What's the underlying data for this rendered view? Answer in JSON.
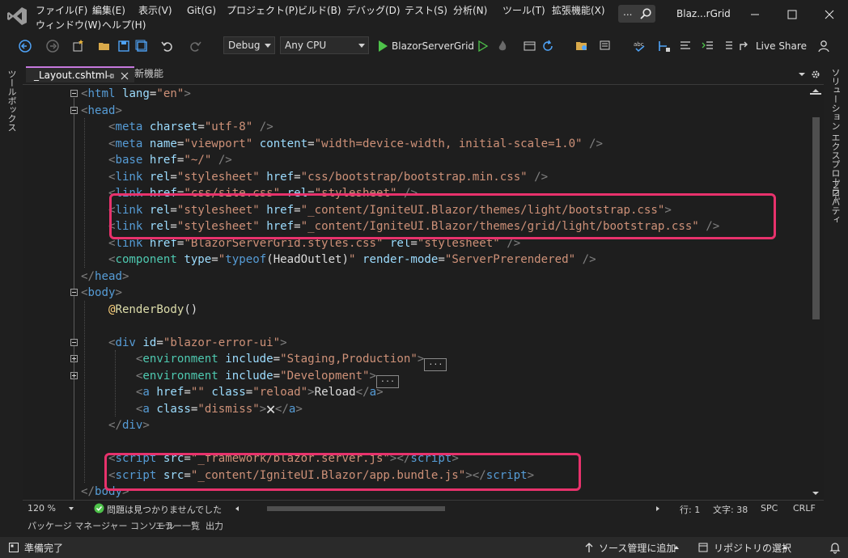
{
  "menu": {
    "items": [
      "ファイル(F)",
      "編集(E)",
      "表示(V)",
      "Git(G)",
      "プロジェクト(P)",
      "ビルド(B)",
      "デバッグ(D)",
      "テスト(S)",
      "分析(N)",
      "ツール(T)",
      "拡張機能(X)"
    ],
    "items2": [
      "ウィンドウ(W)",
      "ヘルプ(H)"
    ],
    "search_dots": "...",
    "window_title": "Blaz...rGrid"
  },
  "toolbar": {
    "config": "Debug",
    "platform": "Any CPU",
    "run_target": "BlazorServerGrid",
    "live_share": "Live Share"
  },
  "side": {
    "left_label": "ツールボックス",
    "right_label_1": "ソリューション エクスプローラー",
    "right_label_2": "プロパティ"
  },
  "tabs": {
    "active": "_Layout.cshtml",
    "second": "新機能"
  },
  "code": {
    "lines": [
      [
        [
          "t-br",
          "<"
        ],
        [
          "t-tag",
          "html"
        ],
        [
          "t-txt",
          " "
        ],
        [
          "t-attr",
          "lang"
        ],
        [
          "t-txt",
          "="
        ],
        [
          "t-str",
          "\"en\""
        ],
        [
          "t-br",
          ">"
        ]
      ],
      [
        [
          "t-br",
          "<"
        ],
        [
          "t-tag",
          "head"
        ],
        [
          "t-br",
          ">"
        ]
      ],
      [
        [
          "t-txt",
          "    "
        ],
        [
          "t-br",
          "<"
        ],
        [
          "t-tag",
          "meta"
        ],
        [
          "t-txt",
          " "
        ],
        [
          "t-attr",
          "charset"
        ],
        [
          "t-txt",
          "="
        ],
        [
          "t-str",
          "\"utf-8\""
        ],
        [
          "t-txt",
          " "
        ],
        [
          "t-br",
          "/>"
        ]
      ],
      [
        [
          "t-txt",
          "    "
        ],
        [
          "t-br",
          "<"
        ],
        [
          "t-tag",
          "meta"
        ],
        [
          "t-txt",
          " "
        ],
        [
          "t-attr",
          "name"
        ],
        [
          "t-txt",
          "="
        ],
        [
          "t-str",
          "\"viewport\""
        ],
        [
          "t-txt",
          " "
        ],
        [
          "t-attr",
          "content"
        ],
        [
          "t-txt",
          "="
        ],
        [
          "t-str",
          "\"width=device-width, initial-scale=1.0\""
        ],
        [
          "t-txt",
          " "
        ],
        [
          "t-br",
          "/>"
        ]
      ],
      [
        [
          "t-txt",
          "    "
        ],
        [
          "t-br",
          "<"
        ],
        [
          "t-tag",
          "base"
        ],
        [
          "t-txt",
          " "
        ],
        [
          "t-attr",
          "href"
        ],
        [
          "t-txt",
          "="
        ],
        [
          "t-str",
          "\"~/\""
        ],
        [
          "t-txt",
          " "
        ],
        [
          "t-br",
          "/>"
        ]
      ],
      [
        [
          "t-txt",
          "    "
        ],
        [
          "t-br",
          "<"
        ],
        [
          "t-tag",
          "link"
        ],
        [
          "t-txt",
          " "
        ],
        [
          "t-attr",
          "rel"
        ],
        [
          "t-txt",
          "="
        ],
        [
          "t-str",
          "\"stylesheet\""
        ],
        [
          "t-txt",
          " "
        ],
        [
          "t-attr",
          "href"
        ],
        [
          "t-txt",
          "="
        ],
        [
          "t-str",
          "\"css/bootstrap/bootstrap.min.css\""
        ],
        [
          "t-txt",
          " "
        ],
        [
          "t-br",
          "/>"
        ]
      ],
      [
        [
          "t-txt",
          "    "
        ],
        [
          "t-br",
          "<"
        ],
        [
          "t-tag",
          "link"
        ],
        [
          "t-txt",
          " "
        ],
        [
          "t-attr",
          "href"
        ],
        [
          "t-txt",
          "="
        ],
        [
          "t-str",
          "\"css/site.css\""
        ],
        [
          "t-txt",
          " "
        ],
        [
          "t-attr",
          "rel"
        ],
        [
          "t-txt",
          "="
        ],
        [
          "t-str",
          "\"stylesheet\""
        ],
        [
          "t-txt",
          " "
        ],
        [
          "t-br",
          "/>"
        ]
      ],
      [
        [
          "t-txt",
          "    "
        ],
        [
          "t-br",
          "<"
        ],
        [
          "t-tag",
          "link"
        ],
        [
          "t-txt",
          " "
        ],
        [
          "t-attr",
          "rel"
        ],
        [
          "t-txt",
          "="
        ],
        [
          "t-str",
          "\"stylesheet\""
        ],
        [
          "t-txt",
          " "
        ],
        [
          "t-attr",
          "href"
        ],
        [
          "t-txt",
          "="
        ],
        [
          "t-str",
          "\"_content/IgniteUI.Blazor/themes/light/bootstrap.css\""
        ],
        [
          "t-br",
          ">"
        ]
      ],
      [
        [
          "t-txt",
          "    "
        ],
        [
          "t-br",
          "<"
        ],
        [
          "t-tag",
          "link"
        ],
        [
          "t-txt",
          " "
        ],
        [
          "t-attr",
          "rel"
        ],
        [
          "t-txt",
          "="
        ],
        [
          "t-str",
          "\"stylesheet\""
        ],
        [
          "t-txt",
          " "
        ],
        [
          "t-attr",
          "href"
        ],
        [
          "t-txt",
          "="
        ],
        [
          "t-str",
          "\"_content/IgniteUI.Blazor/themes/grid/light/bootstrap.css\""
        ],
        [
          "t-txt",
          " "
        ],
        [
          "t-br",
          "/>"
        ]
      ],
      [
        [
          "t-txt",
          "    "
        ],
        [
          "t-br",
          "<"
        ],
        [
          "t-tag",
          "link"
        ],
        [
          "t-txt",
          " "
        ],
        [
          "t-attr",
          "href"
        ],
        [
          "t-txt",
          "="
        ],
        [
          "t-str",
          "\"BlazorServerGrid.styles.css\""
        ],
        [
          "t-txt",
          " "
        ],
        [
          "t-attr",
          "rel"
        ],
        [
          "t-txt",
          "="
        ],
        [
          "t-str",
          "\"stylesheet\""
        ],
        [
          "t-txt",
          " "
        ],
        [
          "t-br",
          "/>"
        ]
      ],
      [
        [
          "t-txt",
          "    "
        ],
        [
          "t-br",
          "<"
        ],
        [
          "t-comp",
          "component"
        ],
        [
          "t-txt",
          " "
        ],
        [
          "t-attr",
          "type"
        ],
        [
          "t-txt",
          "="
        ],
        [
          "t-str",
          "\""
        ],
        [
          "t-tag",
          "typeof"
        ],
        [
          "t-txt",
          "(HeadOutlet)"
        ],
        [
          "t-str",
          "\""
        ],
        [
          "t-txt",
          " "
        ],
        [
          "t-attr",
          "render-mode"
        ],
        [
          "t-txt",
          "="
        ],
        [
          "t-str",
          "\"ServerPrerendered\""
        ],
        [
          "t-txt",
          " "
        ],
        [
          "t-br",
          "/>"
        ]
      ],
      [
        [
          "t-br",
          "</"
        ],
        [
          "t-tag",
          "head"
        ],
        [
          "t-br",
          ">"
        ]
      ],
      [
        [
          "t-br",
          "<"
        ],
        [
          "t-tag",
          "body"
        ],
        [
          "t-br",
          ">"
        ]
      ],
      [
        [
          "t-txt",
          "    "
        ],
        [
          "t-at",
          "@"
        ],
        [
          "t-fn",
          "RenderBody"
        ],
        [
          "t-txt",
          "()"
        ]
      ],
      [
        [
          "t-txt",
          ""
        ]
      ],
      [
        [
          "t-txt",
          "    "
        ],
        [
          "t-br",
          "<"
        ],
        [
          "t-tag",
          "div"
        ],
        [
          "t-txt",
          " "
        ],
        [
          "t-attr",
          "id"
        ],
        [
          "t-txt",
          "="
        ],
        [
          "t-str",
          "\"blazor-error-ui\""
        ],
        [
          "t-br",
          ">"
        ]
      ],
      [
        [
          "t-txt",
          "        "
        ],
        [
          "t-br",
          "<"
        ],
        [
          "t-comp",
          "environment"
        ],
        [
          "t-txt",
          " "
        ],
        [
          "t-attr",
          "include"
        ],
        [
          "t-txt",
          "="
        ],
        [
          "t-str",
          "\"Staging,Production\""
        ],
        [
          "t-br",
          ">"
        ],
        [
          "collapsed",
          "..."
        ]
      ],
      [
        [
          "t-txt",
          "        "
        ],
        [
          "t-br",
          "<"
        ],
        [
          "t-comp",
          "environment"
        ],
        [
          "t-txt",
          " "
        ],
        [
          "t-attr",
          "include"
        ],
        [
          "t-txt",
          "="
        ],
        [
          "t-str",
          "\"Development\""
        ],
        [
          "t-br",
          ">"
        ],
        [
          "collapsed",
          "..."
        ]
      ],
      [
        [
          "t-txt",
          "        "
        ],
        [
          "t-br",
          "<"
        ],
        [
          "t-tag",
          "a"
        ],
        [
          "t-txt",
          " "
        ],
        [
          "t-attr",
          "href"
        ],
        [
          "t-txt",
          "="
        ],
        [
          "t-str",
          "\"\""
        ],
        [
          "t-txt",
          " "
        ],
        [
          "t-attr",
          "class"
        ],
        [
          "t-txt",
          "="
        ],
        [
          "t-str",
          "\"reload\""
        ],
        [
          "t-br",
          ">"
        ],
        [
          "t-txt",
          "Reload"
        ],
        [
          "t-br",
          "</"
        ],
        [
          "t-tag",
          "a"
        ],
        [
          "t-br",
          ">"
        ]
      ],
      [
        [
          "t-txt",
          "        "
        ],
        [
          "t-br",
          "<"
        ],
        [
          "t-tag",
          "a"
        ],
        [
          "t-txt",
          " "
        ],
        [
          "t-attr",
          "class"
        ],
        [
          "t-txt",
          "="
        ],
        [
          "t-str",
          "\"dismiss\""
        ],
        [
          "t-br",
          ">"
        ],
        [
          "t-txt",
          "🗙"
        ],
        [
          "t-br",
          "</"
        ],
        [
          "t-tag",
          "a"
        ],
        [
          "t-br",
          ">"
        ]
      ],
      [
        [
          "t-txt",
          "    "
        ],
        [
          "t-br",
          "</"
        ],
        [
          "t-tag",
          "div"
        ],
        [
          "t-br",
          ">"
        ]
      ],
      [
        [
          "t-txt",
          ""
        ]
      ],
      [
        [
          "t-txt",
          "    "
        ],
        [
          "t-br",
          "<"
        ],
        [
          "t-tag",
          "script"
        ],
        [
          "t-txt",
          " "
        ],
        [
          "t-attr",
          "src"
        ],
        [
          "t-txt",
          "="
        ],
        [
          "t-str",
          "\"_framework/blazor.server.js\""
        ],
        [
          "t-br",
          "></"
        ],
        [
          "t-tag",
          "script"
        ],
        [
          "t-br",
          ">"
        ]
      ],
      [
        [
          "t-txt",
          "    "
        ],
        [
          "t-br",
          "<"
        ],
        [
          "t-tag",
          "script"
        ],
        [
          "t-txt",
          " "
        ],
        [
          "t-attr",
          "src"
        ],
        [
          "t-txt",
          "="
        ],
        [
          "t-str",
          "\"_content/IgniteUI.Blazor/app.bundle.js\""
        ],
        [
          "t-br",
          "></"
        ],
        [
          "t-tag",
          "script"
        ],
        [
          "t-br",
          ">"
        ]
      ],
      [
        [
          "t-br",
          "</"
        ],
        [
          "t-tag",
          "body"
        ],
        [
          "t-br",
          ">"
        ]
      ]
    ]
  },
  "editor_status": {
    "zoom": "120 %",
    "issues": "問題は見つかりませんでした",
    "line": "行: 1",
    "char": "文字: 38",
    "spc": "SPC",
    "crlf": "CRLF"
  },
  "bottom_tabs": [
    "パッケージ マネージャー コンソール",
    "エラー一覧",
    "出力"
  ],
  "statusbar": {
    "ready": "準備完了",
    "source_control": "ソース管理に追加",
    "repository": "リポジトリの選択"
  },
  "colors": {
    "highlight": "#e8326c",
    "accent": "#c678dd",
    "run_green": "#4ec24a"
  }
}
